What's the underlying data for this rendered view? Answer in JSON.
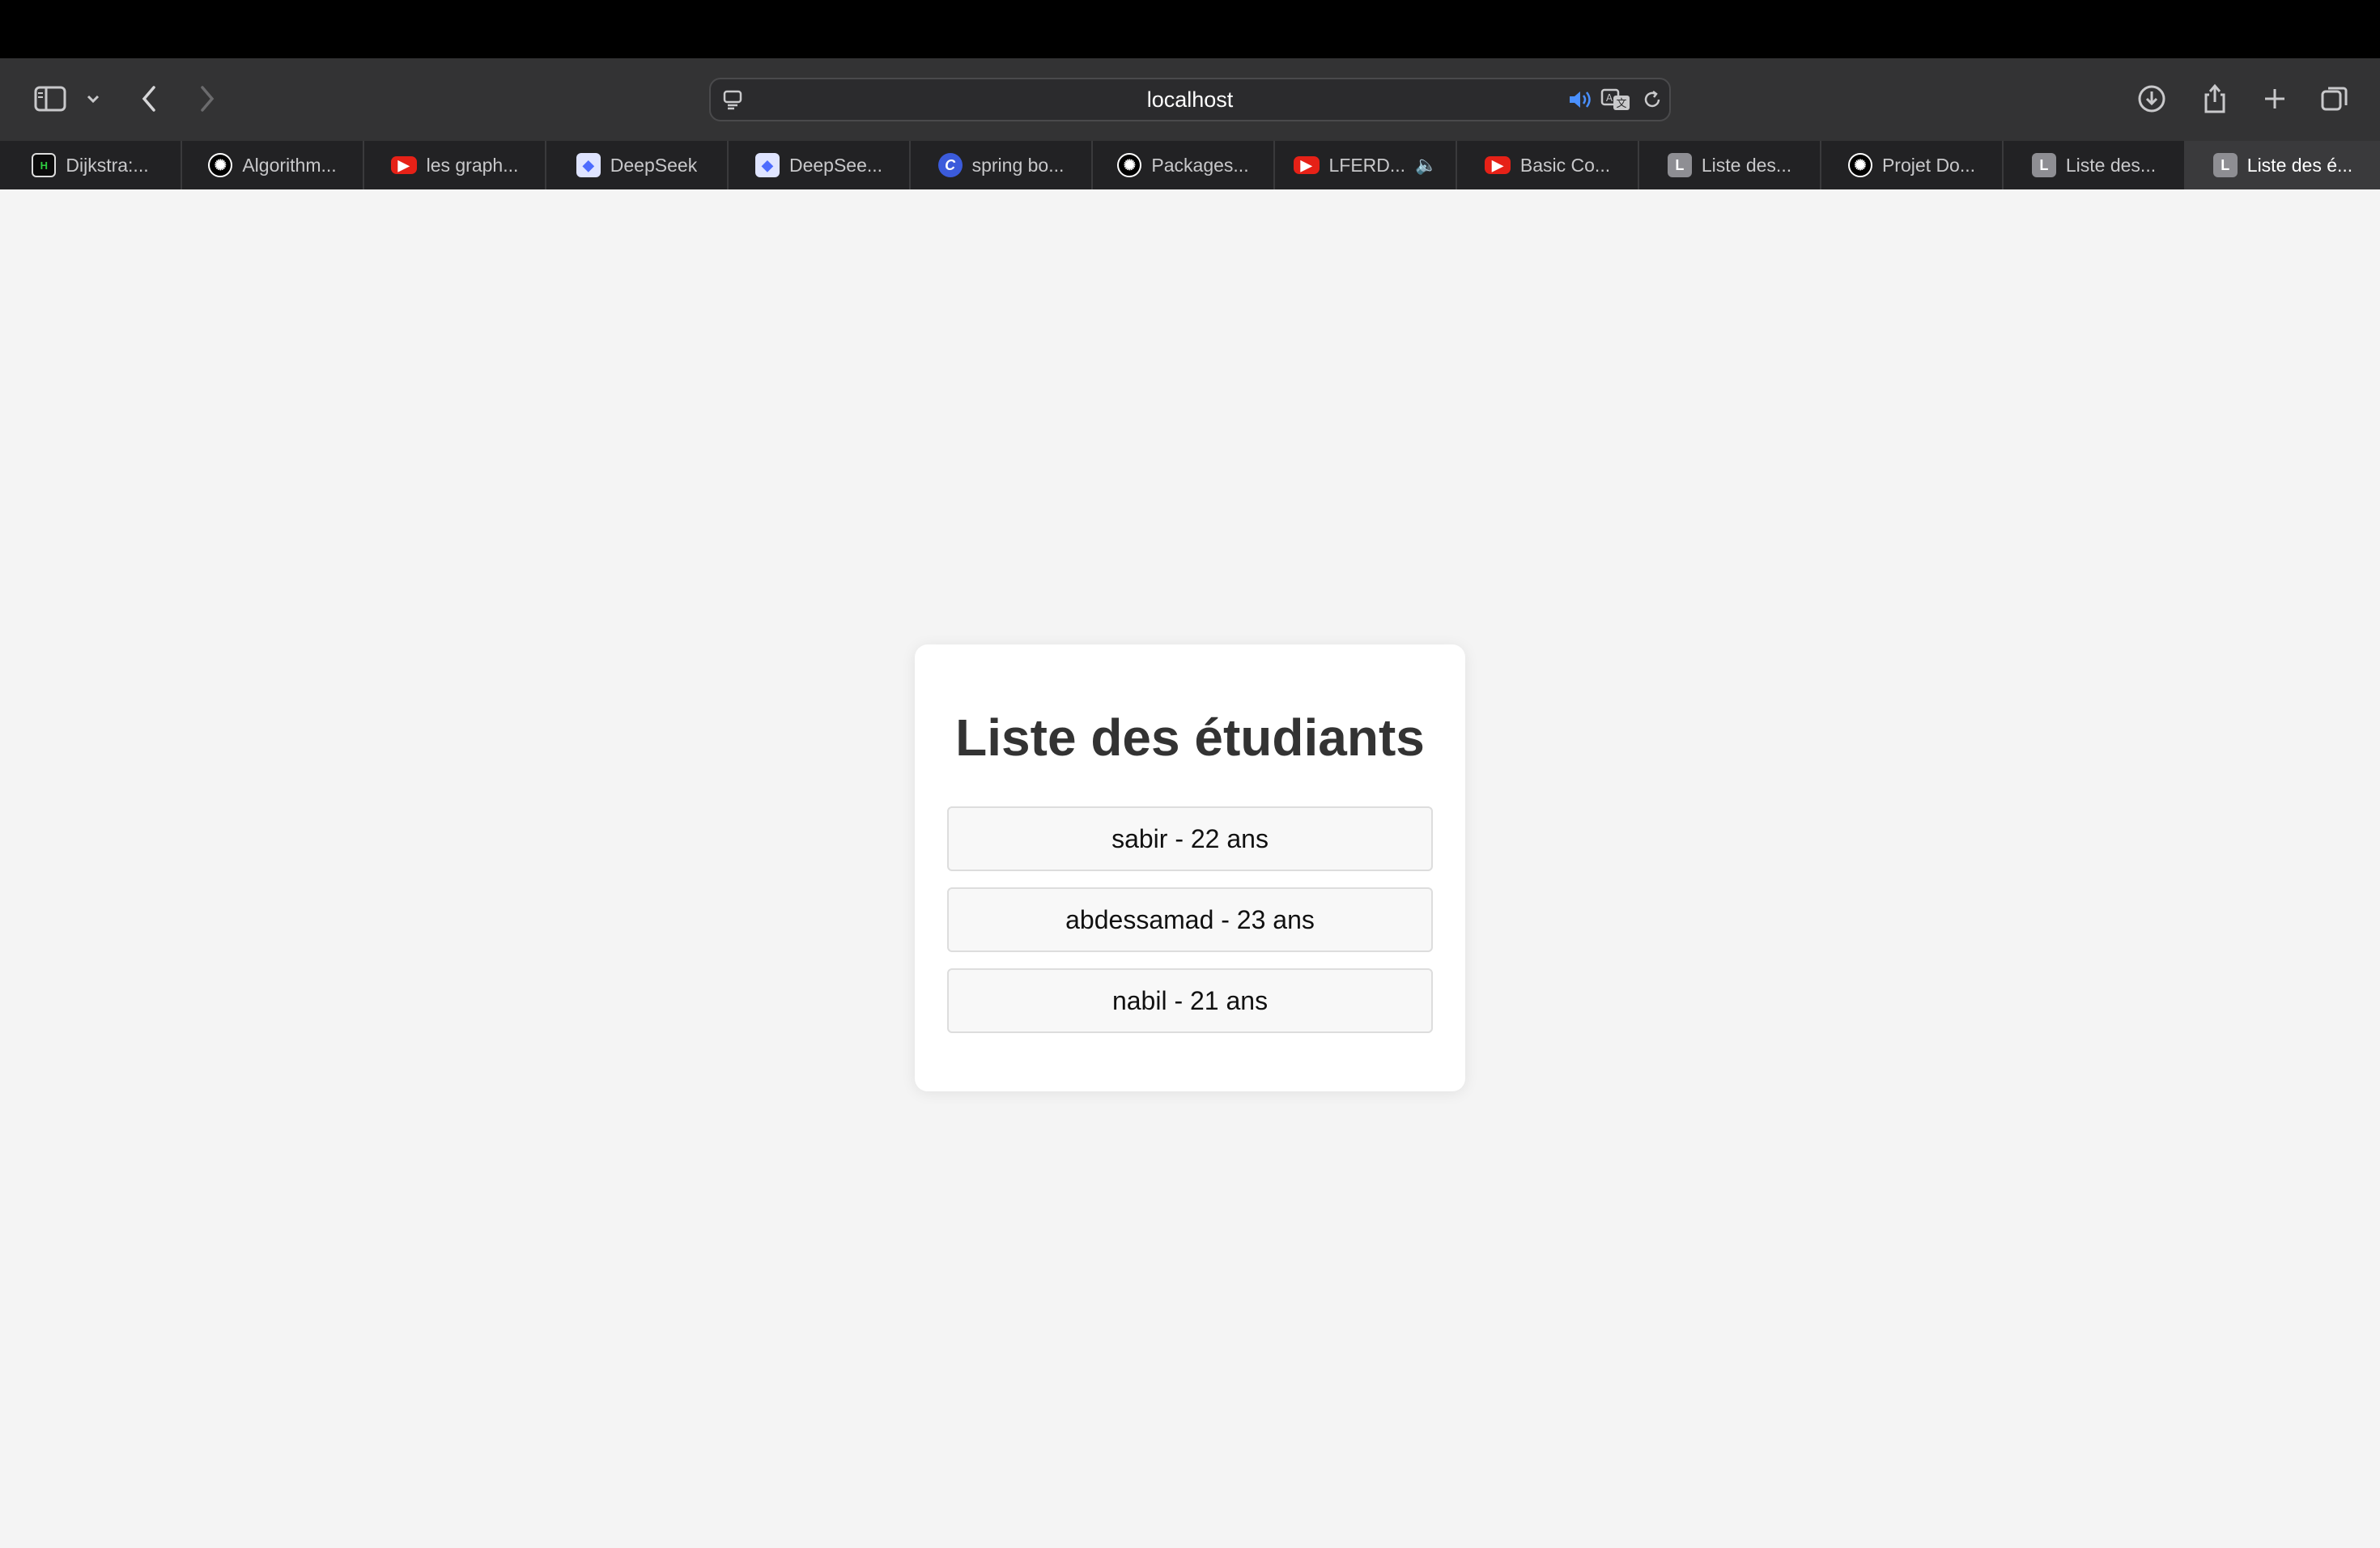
{
  "browser": {
    "address": "localhost",
    "tabs": [
      {
        "label": "Dijkstra:...",
        "favicon": "hackerearth-icon",
        "initial": "H"
      },
      {
        "label": "Algorithm...",
        "favicon": "chatgpt-icon",
        "initial": ""
      },
      {
        "label": "les graph...",
        "favicon": "youtube-icon",
        "initial": ""
      },
      {
        "label": "DeepSeek",
        "favicon": "deepseek-icon",
        "initial": ""
      },
      {
        "label": "DeepSee...",
        "favicon": "deepseek-icon",
        "initial": ""
      },
      {
        "label": "spring bo...",
        "favicon": "c-icon",
        "initial": "C"
      },
      {
        "label": "Packages...",
        "favicon": "chatgpt-icon",
        "initial": ""
      },
      {
        "label": "LFERD...",
        "favicon": "youtube-icon",
        "initial": ""
      },
      {
        "label": "Basic Co...",
        "favicon": "youtube-icon",
        "initial": ""
      },
      {
        "label": "Liste des...",
        "favicon": "letter-icon",
        "initial": "L"
      },
      {
        "label": "Projet Do...",
        "favicon": "chatgpt-icon",
        "initial": ""
      },
      {
        "label": "Liste des...",
        "favicon": "letter-icon",
        "initial": "L"
      },
      {
        "label": "Liste des é...",
        "favicon": "letter-icon",
        "initial": "L"
      }
    ]
  },
  "page": {
    "title": "Liste des étudiants",
    "students": [
      {
        "text": "sabir - 22 ans"
      },
      {
        "text": "abdessamad - 23 ans"
      },
      {
        "text": "nabil - 21 ans"
      }
    ]
  },
  "colors": {
    "page_bg": "#f4f4f4",
    "card_bg": "#ffffff",
    "item_bg": "#f8f8f8",
    "title": "#333333"
  }
}
